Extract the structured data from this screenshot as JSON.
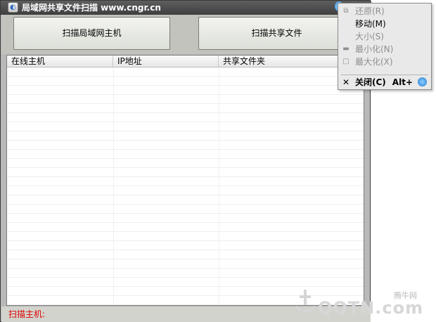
{
  "window": {
    "title": "局域网共享文件扫描 www.cngr.cn",
    "icon": "app-icon"
  },
  "toolbar": {
    "scan_hosts_label": "扫描局域网主机",
    "scan_share_label": "扫描共享文件"
  },
  "list": {
    "columns": [
      "在线主机",
      "IP地址",
      "共享文件夹"
    ],
    "rows": []
  },
  "status": {
    "label": "扫描主机:"
  },
  "context_menu": {
    "items": [
      {
        "label": "还原(R)",
        "enabled": false,
        "icon": "restore-icon"
      },
      {
        "label": "移动(M)",
        "enabled": true
      },
      {
        "label": "大小(S)",
        "enabled": false
      },
      {
        "label": "最小化(N)",
        "enabled": false,
        "icon": "minimize-icon"
      },
      {
        "label": "最大化(X)",
        "enabled": false,
        "icon": "maximize-icon"
      },
      {
        "label": "关闭(C)",
        "enabled": true,
        "icon": "close-icon",
        "shortcut": "Alt+"
      }
    ]
  },
  "watermark": {
    "small": "腾牛网",
    "big": "QQTN.com"
  },
  "colors": {
    "titlebar": "#4a4a4a",
    "status_text": "#e00000",
    "menu_bg": "#e9e9e9"
  }
}
